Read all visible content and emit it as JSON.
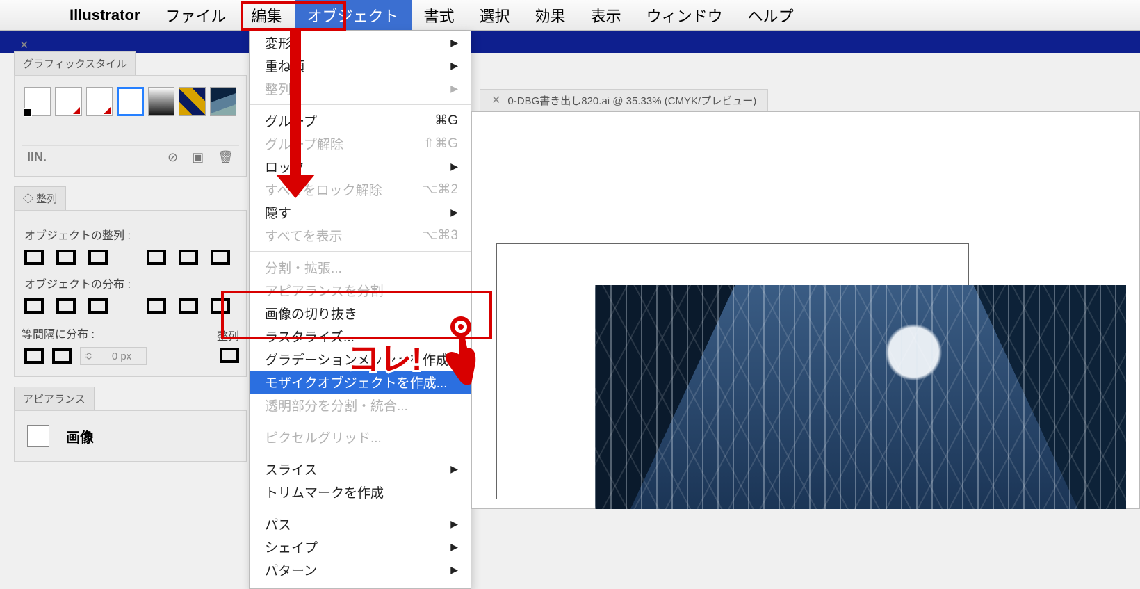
{
  "menubar": {
    "app": "Illustrator",
    "items": [
      "ファイル",
      "編集",
      "オブジェクト",
      "書式",
      "選択",
      "効果",
      "表示",
      "ウィンドウ",
      "ヘルプ"
    ],
    "active_index": 2
  },
  "panels": {
    "graphic_style_tab": "グラフィックスタイル",
    "lib_icon": "IIN.",
    "align_tab": "整列",
    "align_section": "オブジェクトの整列 :",
    "distribute_section": "オブジェクトの分布 :",
    "spacing_section": "等間隔に分布 :",
    "spacing_label_right": "整列",
    "px_value": "0 px",
    "appearance_tab": "アピアランス",
    "appearance_item": "画像"
  },
  "dropdown": [
    {
      "label": "変形",
      "arrow": true
    },
    {
      "label": "重ね順",
      "arrow": true
    },
    {
      "label": "整列",
      "arrow": true,
      "disabled": true
    },
    {
      "sep": true
    },
    {
      "label": "グループ",
      "short": "⌘G"
    },
    {
      "label": "グループ解除",
      "short": "⇧⌘G",
      "disabled": true
    },
    {
      "label": "ロック",
      "arrow": true
    },
    {
      "label": "すべてをロック解除",
      "short": "⌥⌘2",
      "disabled": true
    },
    {
      "label": "隠す",
      "arrow": true
    },
    {
      "label": "すべてを表示",
      "short": "⌥⌘3",
      "disabled": true
    },
    {
      "sep": true
    },
    {
      "label": "分割・拡張...",
      "disabled": true
    },
    {
      "label": "アピアランスを分割",
      "disabled": true
    },
    {
      "label": "画像の切り抜き"
    },
    {
      "label": "ラスタライズ..."
    },
    {
      "label": "グラデーションメッシュを作成..."
    },
    {
      "label": "モザイクオブジェクトを作成...",
      "hl": true
    },
    {
      "label": "透明部分を分割・統合...",
      "disabled": true
    },
    {
      "sep": true
    },
    {
      "label": "ピクセルグリッド...",
      "disabled": true
    },
    {
      "sep": true
    },
    {
      "label": "スライス",
      "arrow": true
    },
    {
      "label": "トリムマークを作成"
    },
    {
      "sep": true
    },
    {
      "label": "パス",
      "arrow": true
    },
    {
      "label": "シェイプ",
      "arrow": true
    },
    {
      "label": "パターン",
      "arrow": true
    }
  ],
  "doc_tab": "0-DBG書き出し820.ai @ 35.33% (CMYK/プレビュー)",
  "annotation_text": "コレ!"
}
